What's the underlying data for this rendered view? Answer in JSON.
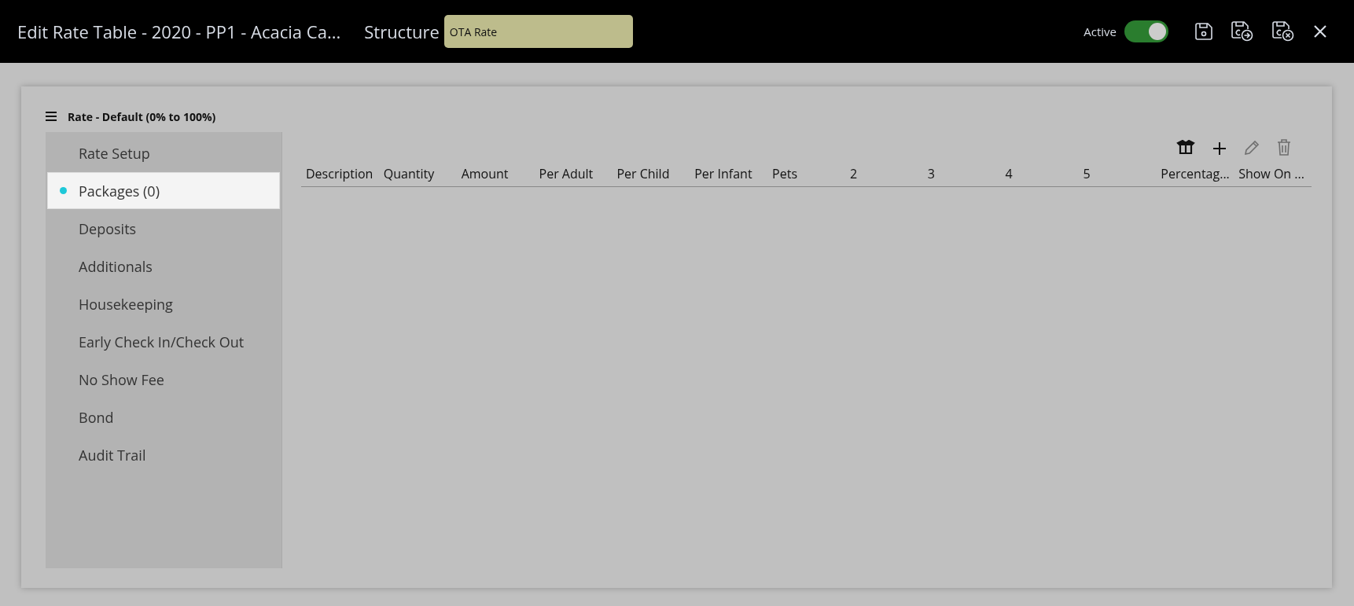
{
  "header": {
    "title": "Edit Rate Table - 2020 - PP1 - Acacia Ca...",
    "structure_label": "Structure",
    "structure_value": "OTA Rate",
    "active_label": "Active",
    "active_on": true
  },
  "panel": {
    "title": "Rate - Default (0% to 100%)"
  },
  "sidebar": {
    "items": [
      {
        "label": "Rate Setup",
        "selected": false
      },
      {
        "label": "Packages (0)",
        "selected": true
      },
      {
        "label": "Deposits",
        "selected": false
      },
      {
        "label": "Additionals",
        "selected": false
      },
      {
        "label": "Housekeeping",
        "selected": false
      },
      {
        "label": "Early Check In/Check Out",
        "selected": false
      },
      {
        "label": "No Show Fee",
        "selected": false
      },
      {
        "label": "Bond",
        "selected": false
      },
      {
        "label": "Audit Trail",
        "selected": false
      }
    ]
  },
  "toolbar": [
    {
      "kind": "package",
      "disabled": false
    },
    {
      "kind": "add",
      "disabled": false
    },
    {
      "kind": "edit",
      "disabled": true
    },
    {
      "kind": "delete",
      "disabled": true
    }
  ],
  "table": {
    "columns": [
      "Description",
      "Quantity",
      "Amount",
      "Per Adult",
      "Per Child",
      "Per Infant",
      "Pets",
      "2",
      "3",
      "4",
      "5",
      "Percentag...",
      "Show On ..."
    ]
  }
}
